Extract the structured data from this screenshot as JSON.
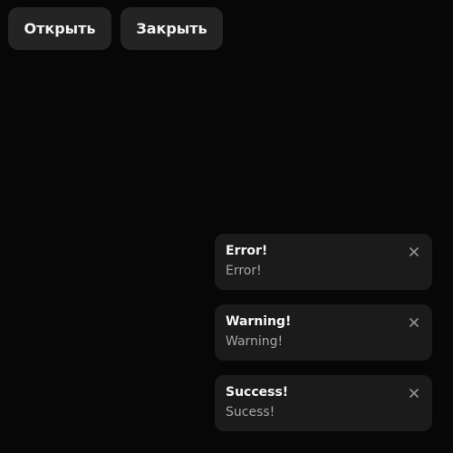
{
  "toolbar": {
    "open_label": "Открыть",
    "close_label": "Закрыть"
  },
  "colors": {
    "background": "#070707",
    "button_bg": "#242424",
    "toast_bg": "#1b1b1b",
    "title_text": "#f5f5f5",
    "message_text": "#a6a6a6",
    "close_icon": "#8e8e8e"
  },
  "toasts": [
    {
      "title": "Error!",
      "message": "Error!",
      "close_icon": "close-icon"
    },
    {
      "title": "Warning!",
      "message": "Warning!",
      "close_icon": "close-icon"
    },
    {
      "title": "Success!",
      "message": "Sucess!",
      "close_icon": "close-icon"
    }
  ]
}
